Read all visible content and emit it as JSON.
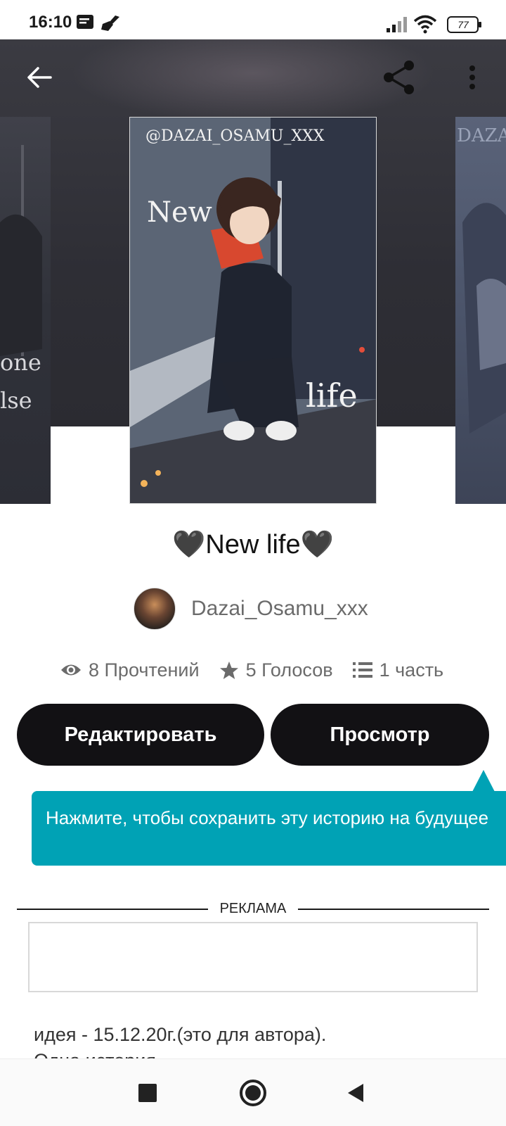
{
  "status_bar": {
    "time": "16:10",
    "battery": "77"
  },
  "cover_overlay": {
    "handle": "@DAZAI_OSAMU_XXX",
    "word1": "New",
    "word2": "life",
    "left_text_1": "one",
    "left_text_2": "lse",
    "right_text": "DAZA"
  },
  "story": {
    "title": "🖤New life🖤",
    "author": "Dazai_Osamu_xxx"
  },
  "stats": {
    "reads": "8 Прочтений",
    "votes": "5 Голосов",
    "parts": "1 часть"
  },
  "buttons": {
    "edit": "Редактировать",
    "preview": "Просмотр"
  },
  "tooltip": {
    "text": "Нажмите, чтобы сохранить эту историю на будущее"
  },
  "ad": {
    "label": "РЕКЛАМА"
  },
  "description": {
    "line1": "идея - 15.12.20г.(это для автора).",
    "line2": "Одна история..."
  },
  "icons": {
    "back": "arrow-left-icon",
    "share": "share-icon",
    "more": "more-vert-icon",
    "eye": "eye-icon",
    "star": "star-icon",
    "list": "list-icon"
  }
}
